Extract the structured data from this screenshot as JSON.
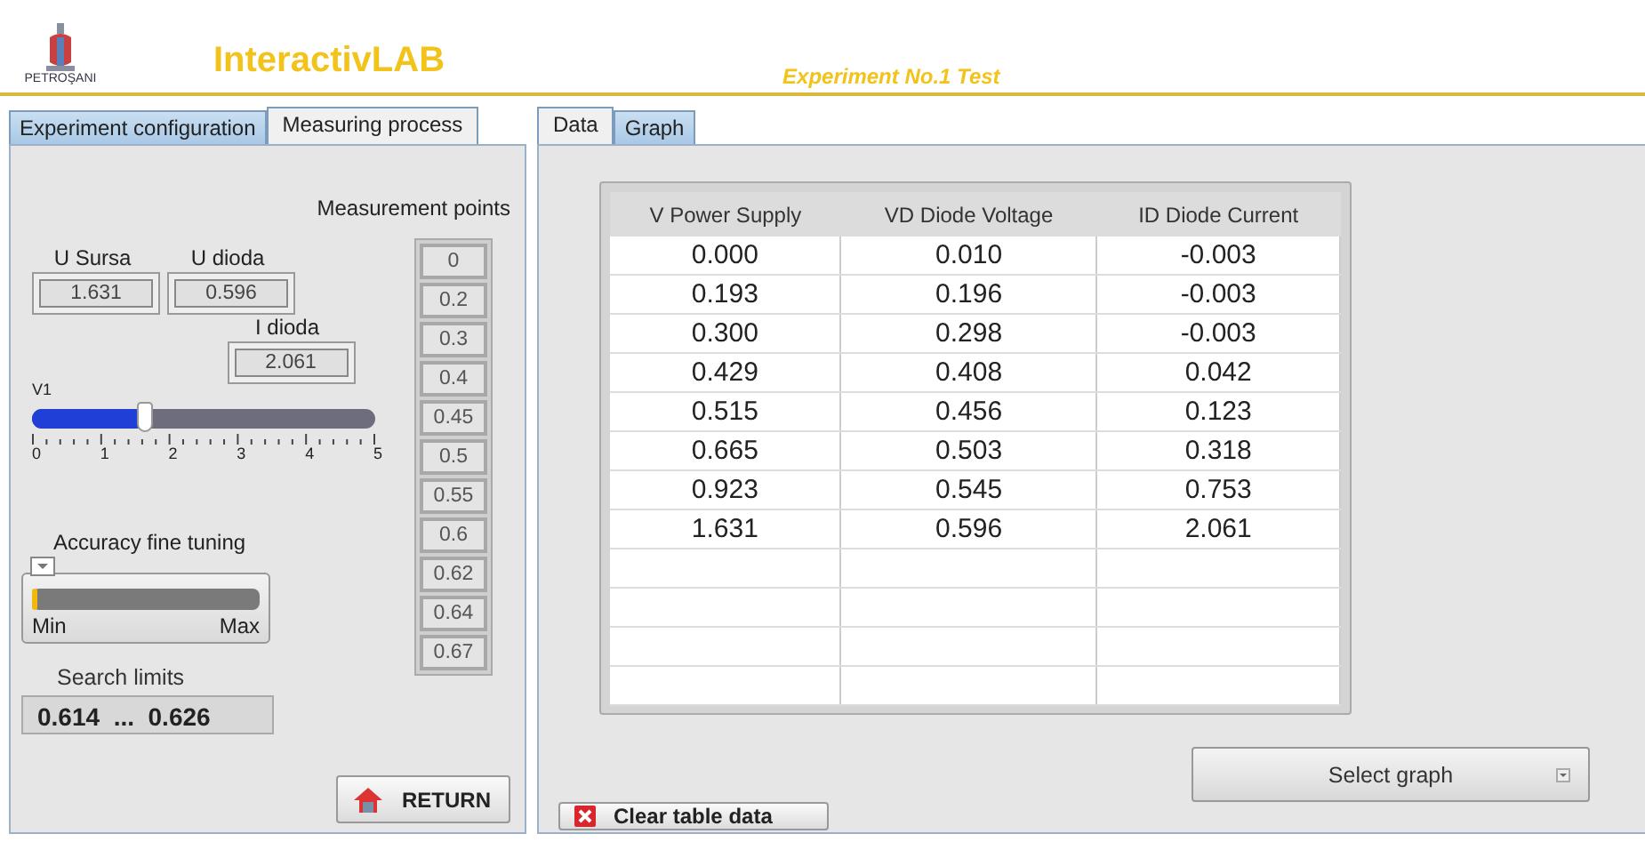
{
  "header": {
    "logo_caption": "PETROŞANI",
    "app_title": "InteractivLAB",
    "experiment_title": "Experiment No.1 Test"
  },
  "left_tabs": [
    {
      "label": "Experiment configuration",
      "selected": false
    },
    {
      "label": "Measuring process",
      "selected": true
    }
  ],
  "measuring": {
    "readouts": [
      {
        "label": "U Sursa",
        "value": "1.631"
      },
      {
        "label": "U dioda",
        "value": "0.596"
      },
      {
        "label": "I dioda",
        "value": "2.061"
      }
    ],
    "v1_slider": {
      "label": "V1",
      "level": 0.326,
      "scale": [
        "0",
        "1",
        "2",
        "3",
        "4",
        "5"
      ]
    },
    "fine_tuning": {
      "label": "Accuracy fine tuning",
      "level": 0.02,
      "min_label": "Min",
      "max_label": "Max"
    },
    "search_limits": {
      "label": "Search limits",
      "value": "0.614  ...  0.626"
    },
    "points_label": "Measurement points",
    "points": [
      "0",
      "0.2",
      "0.3",
      "0.4",
      "0.45",
      "0.5",
      "0.55",
      "0.6",
      "0.62",
      "0.64",
      "0.67"
    ],
    "return_button": "RETURN"
  },
  "right_tabs": [
    {
      "label": "Data",
      "selected": true
    },
    {
      "label": "Graph",
      "selected": false
    }
  ],
  "table": {
    "columns": [
      "V Power Supply",
      "VD Diode Voltage",
      "ID Diode Current"
    ],
    "rows": [
      [
        "0.000",
        "0.010",
        "-0.003"
      ],
      [
        "0.193",
        "0.196",
        "-0.003"
      ],
      [
        "0.300",
        "0.298",
        "-0.003"
      ],
      [
        "0.429",
        "0.408",
        "0.042"
      ],
      [
        "0.515",
        "0.456",
        "0.123"
      ],
      [
        "0.665",
        "0.503",
        "0.318"
      ],
      [
        "0.923",
        "0.545",
        "0.753"
      ],
      [
        "1.631",
        "0.596",
        "2.061"
      ]
    ]
  },
  "select_graph": "Select graph",
  "clear_button": "Clear table data"
}
